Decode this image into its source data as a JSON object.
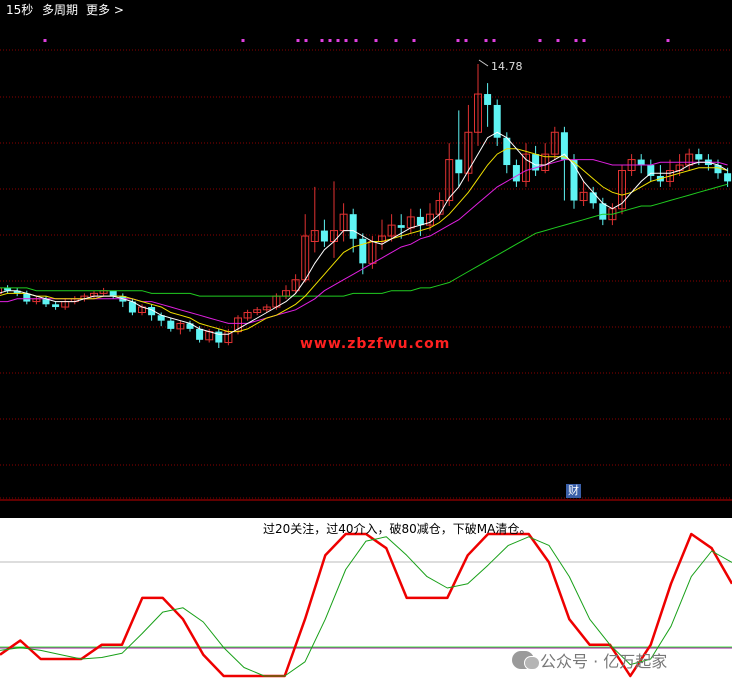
{
  "toolbar": {
    "period": "15秒",
    "multi_period": "多周期",
    "more": "更多",
    "more_icon": "chevron-right-icon"
  },
  "colors": {
    "up": "#e03232",
    "down": "#5ff4f4",
    "ma_short": "#ffffff",
    "ma_mid": "#f0e000",
    "ma_long": "#e020e0",
    "ma_longest": "#20cc20",
    "kdj_red": "#ee0000",
    "kdj_green": "#18a018",
    "grid": "#8a0000",
    "markers": "#e040e0"
  },
  "watermark_url": "www.zbzfwu.com",
  "badge": "财",
  "legend": "过20关注，过40介入，破80减仓，下破MA清仓。",
  "footer": {
    "icon": "wechat-icon",
    "text": "公众号 · 亿万起家"
  },
  "chart_data": [
    {
      "type": "candlestick",
      "peak_label": "14.78",
      "candles": [
        [
          0.11,
          0.13,
          0.09,
          0.12
        ],
        [
          0.13,
          0.12,
          0.11,
          0.14
        ],
        [
          0.12,
          0.11,
          0.1,
          0.13
        ],
        [
          0.11,
          0.08,
          0.07,
          0.12
        ],
        [
          0.08,
          0.09,
          0.07,
          0.1
        ],
        [
          0.09,
          0.07,
          0.06,
          0.1
        ],
        [
          0.07,
          0.06,
          0.05,
          0.08
        ],
        [
          0.06,
          0.08,
          0.05,
          0.09
        ],
        [
          0.08,
          0.09,
          0.07,
          0.1
        ],
        [
          0.09,
          0.1,
          0.08,
          0.11
        ],
        [
          0.1,
          0.11,
          0.09,
          0.12
        ],
        [
          0.11,
          0.12,
          0.1,
          0.13
        ],
        [
          0.12,
          0.1,
          0.09,
          0.12
        ],
        [
          0.1,
          0.08,
          0.06,
          0.11
        ],
        [
          0.08,
          0.04,
          0.03,
          0.09
        ],
        [
          0.04,
          0.06,
          0.03,
          0.07
        ],
        [
          0.06,
          0.03,
          0.01,
          0.07
        ],
        [
          0.03,
          0.01,
          -0.01,
          0.04
        ],
        [
          0.01,
          -0.02,
          -0.03,
          0.02
        ],
        [
          -0.02,
          0.0,
          -0.04,
          0.01
        ],
        [
          0.0,
          -0.02,
          -0.03,
          0.01
        ],
        [
          -0.02,
          -0.06,
          -0.07,
          -0.01
        ],
        [
          -0.06,
          -0.03,
          -0.07,
          -0.02
        ],
        [
          -0.03,
          -0.07,
          -0.09,
          -0.02
        ],
        [
          -0.07,
          -0.03,
          -0.08,
          -0.02
        ],
        [
          -0.03,
          0.02,
          -0.04,
          0.03
        ],
        [
          0.02,
          0.04,
          0.01,
          0.05
        ],
        [
          0.04,
          0.05,
          0.03,
          0.06
        ],
        [
          0.05,
          0.06,
          0.04,
          0.07
        ],
        [
          0.06,
          0.1,
          0.05,
          0.11
        ],
        [
          0.1,
          0.12,
          0.09,
          0.14
        ],
        [
          0.12,
          0.16,
          0.11,
          0.18
        ],
        [
          0.16,
          0.32,
          0.15,
          0.4
        ],
        [
          0.3,
          0.34,
          0.26,
          0.5
        ],
        [
          0.34,
          0.3,
          0.28,
          0.38
        ],
        [
          0.3,
          0.34,
          0.24,
          0.52
        ],
        [
          0.34,
          0.4,
          0.3,
          0.44
        ],
        [
          0.4,
          0.31,
          0.26,
          0.42
        ],
        [
          0.31,
          0.22,
          0.18,
          0.33
        ],
        [
          0.22,
          0.3,
          0.2,
          0.32
        ],
        [
          0.3,
          0.32,
          0.27,
          0.38
        ],
        [
          0.32,
          0.36,
          0.3,
          0.4
        ],
        [
          0.36,
          0.35,
          0.31,
          0.4
        ],
        [
          0.35,
          0.39,
          0.33,
          0.42
        ],
        [
          0.39,
          0.36,
          0.32,
          0.42
        ],
        [
          0.36,
          0.4,
          0.34,
          0.44
        ],
        [
          0.4,
          0.45,
          0.38,
          0.48
        ],
        [
          0.45,
          0.6,
          0.43,
          0.66
        ],
        [
          0.6,
          0.55,
          0.5,
          0.78
        ],
        [
          0.55,
          0.7,
          0.52,
          0.8
        ],
        [
          0.7,
          0.84,
          0.65,
          0.95
        ],
        [
          0.84,
          0.8,
          0.72,
          0.88
        ],
        [
          0.8,
          0.68,
          0.65,
          0.82
        ],
        [
          0.68,
          0.58,
          0.55,
          0.7
        ],
        [
          0.58,
          0.52,
          0.5,
          0.6
        ],
        [
          0.52,
          0.62,
          0.5,
          0.66
        ],
        [
          0.62,
          0.56,
          0.54,
          0.65
        ],
        [
          0.56,
          0.62,
          0.55,
          0.66
        ],
        [
          0.62,
          0.7,
          0.6,
          0.72
        ],
        [
          0.7,
          0.6,
          0.45,
          0.72
        ],
        [
          0.6,
          0.45,
          0.42,
          0.62
        ],
        [
          0.45,
          0.48,
          0.43,
          0.52
        ],
        [
          0.48,
          0.44,
          0.42,
          0.5
        ],
        [
          0.44,
          0.38,
          0.36,
          0.46
        ],
        [
          0.38,
          0.42,
          0.36,
          0.44
        ],
        [
          0.42,
          0.56,
          0.4,
          0.58
        ],
        [
          0.56,
          0.6,
          0.54,
          0.62
        ],
        [
          0.6,
          0.58,
          0.55,
          0.62
        ],
        [
          0.58,
          0.54,
          0.52,
          0.6
        ],
        [
          0.54,
          0.52,
          0.5,
          0.58
        ],
        [
          0.52,
          0.56,
          0.5,
          0.6
        ],
        [
          0.56,
          0.58,
          0.54,
          0.62
        ],
        [
          0.58,
          0.62,
          0.56,
          0.64
        ],
        [
          0.62,
          0.6,
          0.58,
          0.64
        ],
        [
          0.6,
          0.58,
          0.56,
          0.62
        ],
        [
          0.58,
          0.55,
          0.53,
          0.6
        ],
        [
          0.55,
          0.52,
          0.5,
          0.57
        ]
      ],
      "ma_short": [
        0.11,
        0.12,
        0.12,
        0.11,
        0.1,
        0.09,
        0.08,
        0.08,
        0.08,
        0.09,
        0.1,
        0.1,
        0.1,
        0.09,
        0.08,
        0.06,
        0.05,
        0.03,
        0.02,
        0.01,
        0.0,
        -0.02,
        -0.03,
        -0.04,
        -0.04,
        -0.02,
        0.0,
        0.02,
        0.04,
        0.06,
        0.08,
        0.11,
        0.16,
        0.22,
        0.27,
        0.3,
        0.34,
        0.34,
        0.32,
        0.3,
        0.29,
        0.31,
        0.33,
        0.35,
        0.36,
        0.37,
        0.4,
        0.46,
        0.5,
        0.56,
        0.62,
        0.68,
        0.7,
        0.68,
        0.64,
        0.6,
        0.58,
        0.58,
        0.6,
        0.62,
        0.58,
        0.52,
        0.48,
        0.44,
        0.42,
        0.44,
        0.48,
        0.52,
        0.55,
        0.55,
        0.55,
        0.56,
        0.58,
        0.59,
        0.59,
        0.58,
        0.56
      ],
      "ma_mid": [
        0.1,
        0.11,
        0.11,
        0.11,
        0.1,
        0.1,
        0.09,
        0.09,
        0.09,
        0.09,
        0.09,
        0.1,
        0.1,
        0.1,
        0.09,
        0.08,
        0.07,
        0.06,
        0.04,
        0.03,
        0.02,
        0.0,
        -0.01,
        -0.02,
        -0.03,
        -0.03,
        -0.02,
        0.0,
        0.02,
        0.03,
        0.05,
        0.07,
        0.1,
        0.14,
        0.18,
        0.22,
        0.26,
        0.28,
        0.29,
        0.3,
        0.3,
        0.31,
        0.32,
        0.33,
        0.34,
        0.35,
        0.37,
        0.4,
        0.44,
        0.48,
        0.53,
        0.58,
        0.62,
        0.64,
        0.64,
        0.63,
        0.62,
        0.61,
        0.61,
        0.61,
        0.59,
        0.56,
        0.53,
        0.5,
        0.48,
        0.47,
        0.48,
        0.5,
        0.52,
        0.53,
        0.54,
        0.55,
        0.56,
        0.57,
        0.57,
        0.57,
        0.56
      ],
      "ma_long": [
        0.08,
        0.08,
        0.09,
        0.09,
        0.09,
        0.09,
        0.09,
        0.09,
        0.09,
        0.09,
        0.09,
        0.09,
        0.09,
        0.09,
        0.09,
        0.08,
        0.08,
        0.07,
        0.06,
        0.05,
        0.04,
        0.03,
        0.02,
        0.01,
        0.0,
        0.0,
        0.0,
        0.01,
        0.02,
        0.03,
        0.04,
        0.05,
        0.07,
        0.09,
        0.12,
        0.14,
        0.16,
        0.18,
        0.2,
        0.22,
        0.24,
        0.26,
        0.28,
        0.29,
        0.31,
        0.32,
        0.34,
        0.36,
        0.38,
        0.41,
        0.44,
        0.47,
        0.5,
        0.52,
        0.54,
        0.56,
        0.57,
        0.58,
        0.59,
        0.6,
        0.6,
        0.6,
        0.6,
        0.59,
        0.58,
        0.58,
        0.58,
        0.58,
        0.58,
        0.59,
        0.59,
        0.59,
        0.59,
        0.59,
        0.59,
        0.59,
        0.58
      ],
      "ma_longest": [
        0.13,
        0.13,
        0.13,
        0.13,
        0.12,
        0.12,
        0.12,
        0.12,
        0.12,
        0.12,
        0.12,
        0.12,
        0.12,
        0.12,
        0.12,
        0.12,
        0.11,
        0.11,
        0.11,
        0.11,
        0.11,
        0.1,
        0.1,
        0.1,
        0.1,
        0.1,
        0.1,
        0.1,
        0.1,
        0.1,
        0.1,
        0.1,
        0.1,
        0.1,
        0.1,
        0.1,
        0.1,
        0.11,
        0.11,
        0.11,
        0.11,
        0.12,
        0.12,
        0.12,
        0.13,
        0.13,
        0.14,
        0.15,
        0.17,
        0.19,
        0.21,
        0.23,
        0.25,
        0.27,
        0.29,
        0.31,
        0.33,
        0.34,
        0.35,
        0.36,
        0.37,
        0.38,
        0.39,
        0.4,
        0.4,
        0.41,
        0.42,
        0.43,
        0.43,
        0.44,
        0.45,
        0.46,
        0.47,
        0.48,
        0.49,
        0.5,
        0.51
      ]
    },
    {
      "type": "line",
      "series": [
        {
          "values": [
            15,
            25,
            12,
            12,
            12,
            22,
            22,
            55,
            55,
            40,
            15,
            0,
            0,
            0,
            0,
            40,
            85,
            100,
            100,
            90,
            55,
            55,
            55,
            85,
            100,
            100,
            100,
            80,
            40,
            22,
            22,
            0,
            22,
            65,
            100,
            90,
            65
          ]
        },
        {
          "values": [
            18,
            20,
            18,
            15,
            12,
            13,
            16,
            30,
            45,
            48,
            38,
            20,
            6,
            0,
            0,
            10,
            40,
            75,
            95,
            98,
            85,
            70,
            62,
            65,
            78,
            92,
            98,
            92,
            70,
            40,
            22,
            8,
            12,
            35,
            70,
            88,
            80
          ]
        }
      ],
      "ylim": [
        0,
        100
      ],
      "reference_lines": [
        20,
        80
      ]
    }
  ]
}
